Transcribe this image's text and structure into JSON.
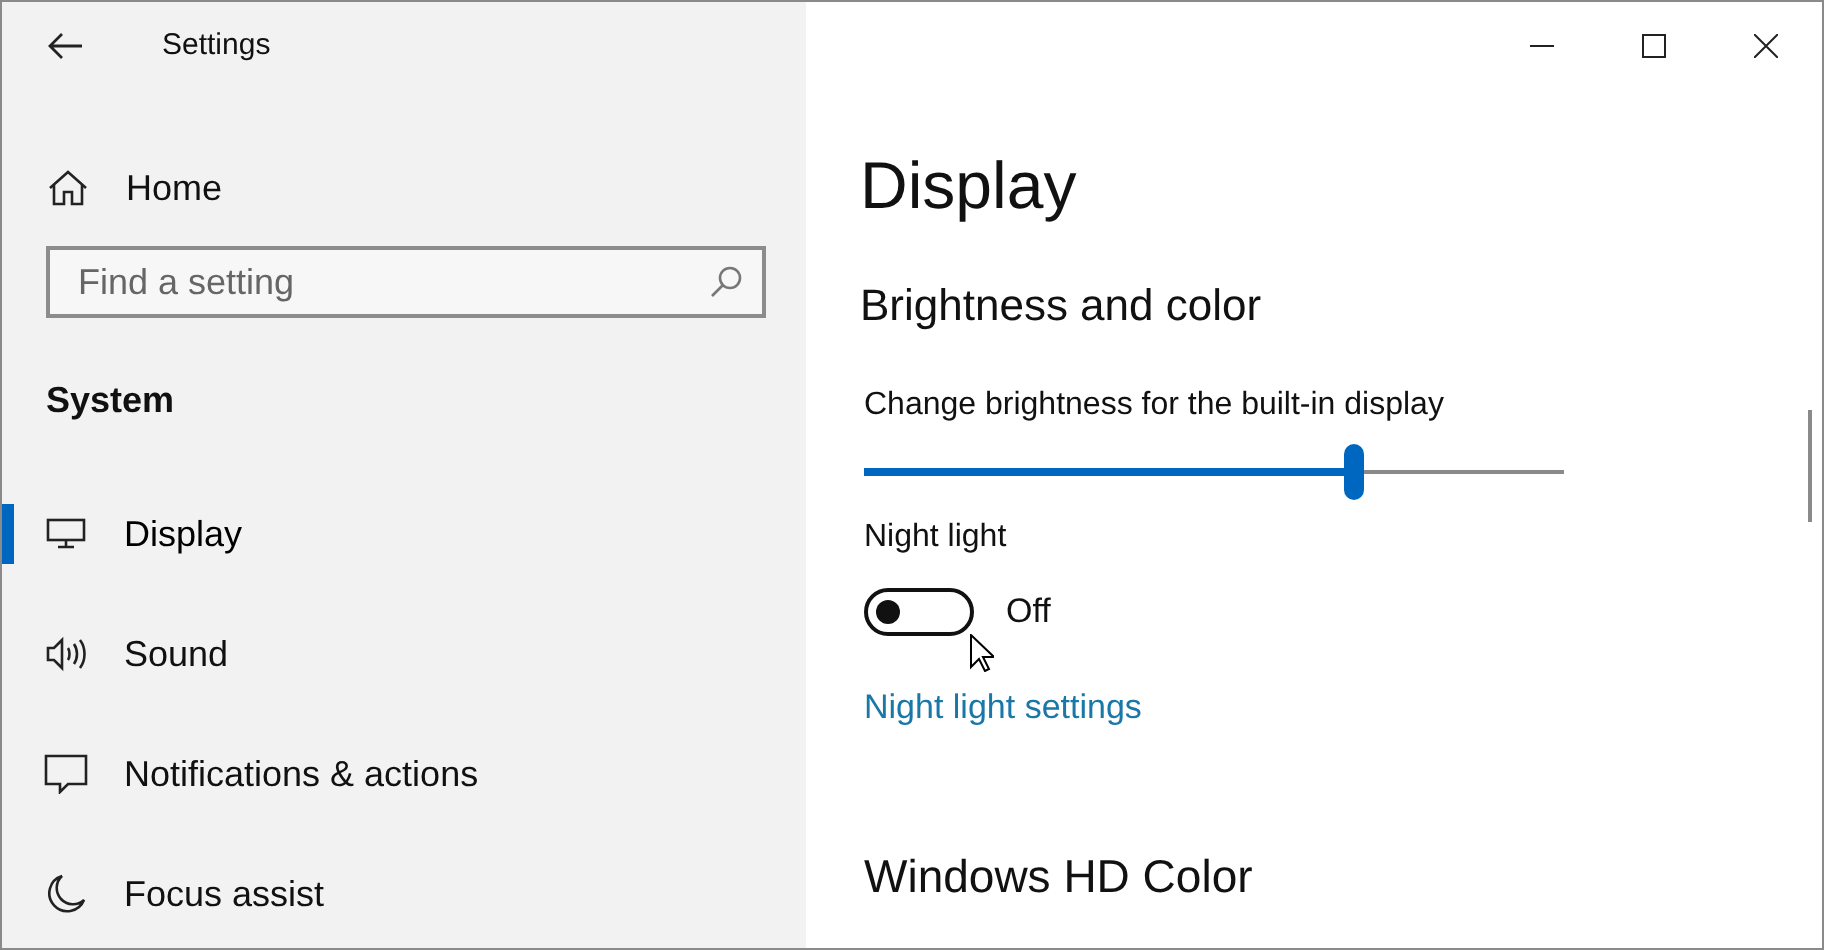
{
  "window": {
    "title": "Settings"
  },
  "sidebar": {
    "home": "Home",
    "search": {
      "placeholder": "Find a setting"
    },
    "section": "System",
    "items": [
      {
        "label": "Display",
        "selected": true
      },
      {
        "label": "Sound",
        "selected": false
      },
      {
        "label": "Notifications & actions",
        "selected": false
      },
      {
        "label": "Focus assist",
        "selected": false
      }
    ]
  },
  "main": {
    "title": "Display",
    "section": "Brightness and color",
    "brightness": {
      "label": "Change brightness for the built-in display",
      "level": 0.7
    },
    "night_light": {
      "label": "Night light",
      "on": false,
      "state_text": "Off",
      "link": "Night light settings"
    },
    "next_section": "Windows HD Color"
  }
}
